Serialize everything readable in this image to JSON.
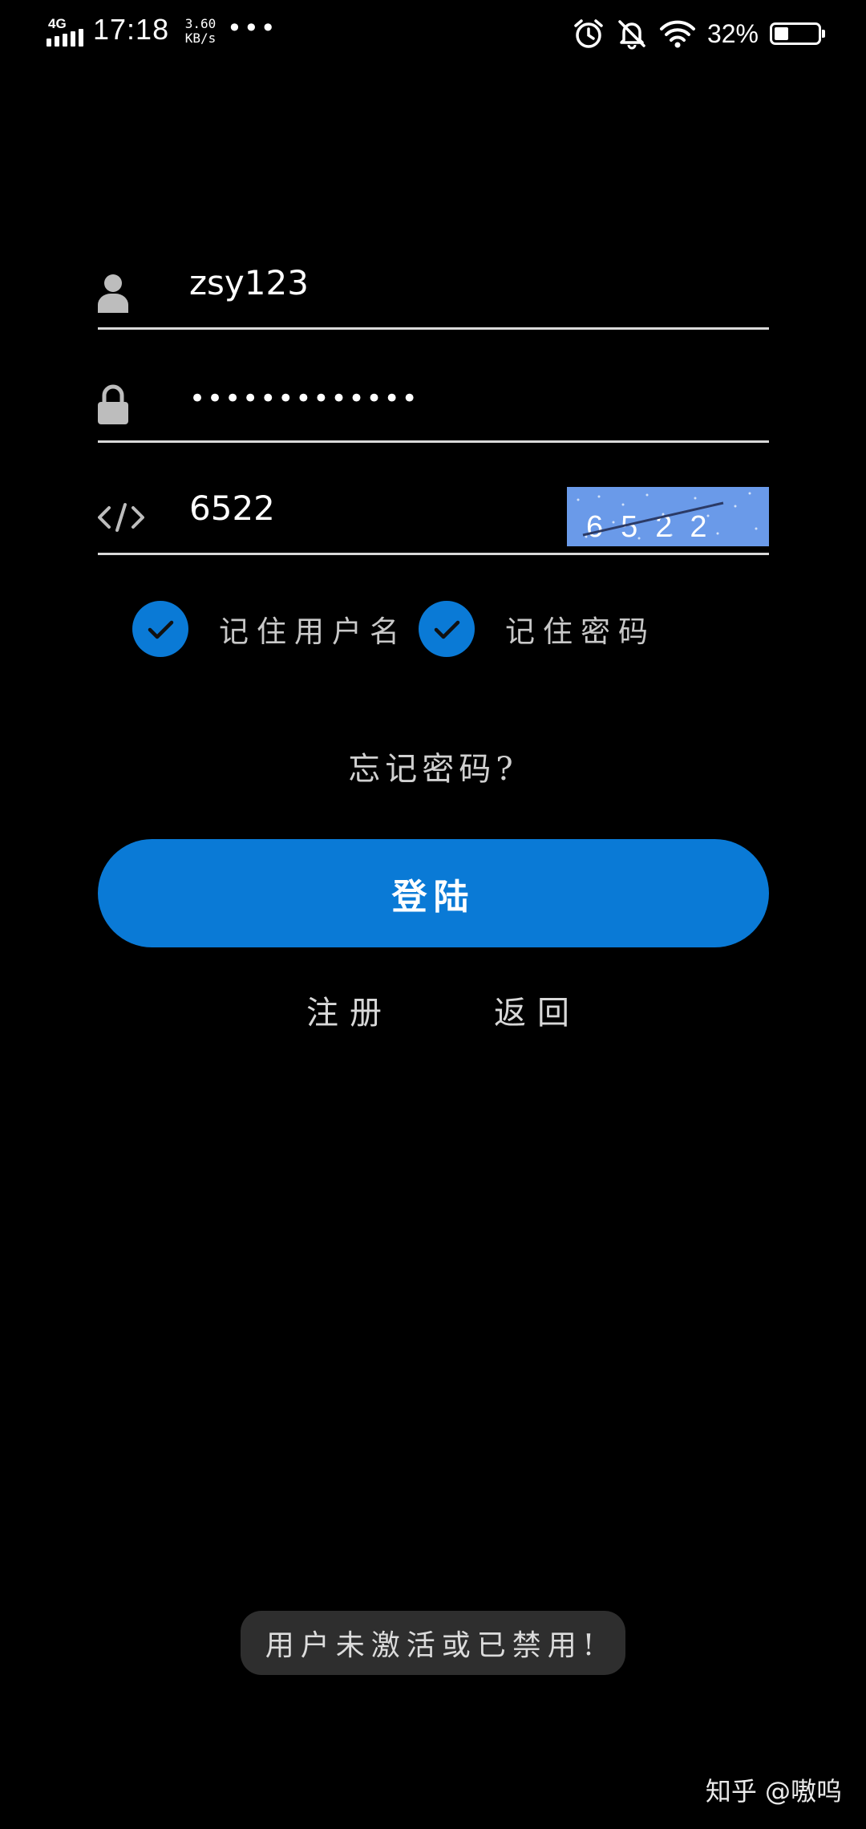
{
  "status_bar": {
    "network_type": "4G",
    "time": "17:18",
    "speed_value": "3.60",
    "speed_unit": "KB/s",
    "more": "•••",
    "battery_percent": "32%",
    "battery_level": 0.32,
    "icons": [
      "alarm-icon",
      "mute-bell-icon",
      "wifi-icon",
      "battery-icon"
    ]
  },
  "form": {
    "username": {
      "value": "zsy123",
      "icon": "user-icon"
    },
    "password": {
      "value": "•••••••••••••",
      "icon": "lock-icon"
    },
    "captcha": {
      "value": "6522",
      "icon": "code-icon",
      "image_text": "6522"
    }
  },
  "checkboxes": {
    "remember_username": {
      "label": "记住用户名",
      "checked": true
    },
    "remember_password": {
      "label": "记住密码",
      "checked": true
    }
  },
  "forgot_password": "忘记密码?",
  "login_button": "登陆",
  "links": {
    "register": "注册",
    "back": "返回"
  },
  "toast": "用户未激活或已禁用!",
  "watermark": "知乎 @嗷呜",
  "colors": {
    "accent": "#0a7ad6",
    "captcha_bg": "#6a9ae9",
    "background": "#000000"
  }
}
